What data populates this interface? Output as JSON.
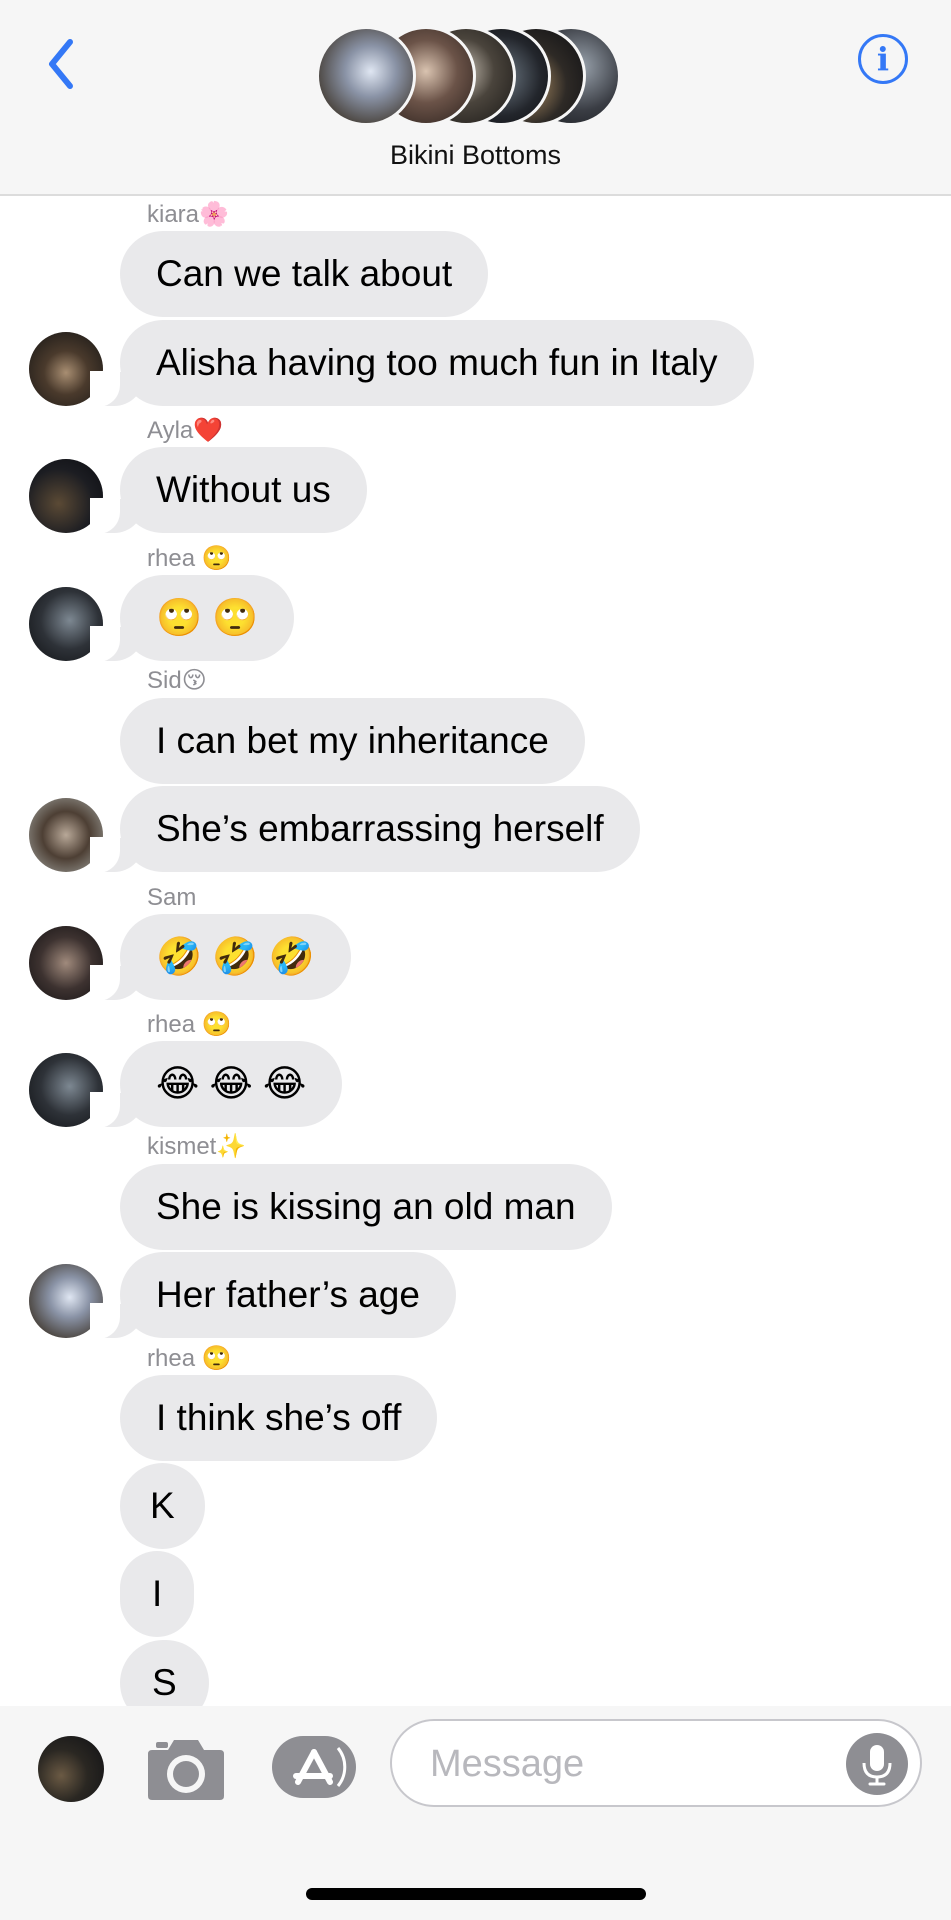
{
  "header": {
    "title": "Bikini Bottoms",
    "back_icon": "chevron-left-icon",
    "info_icon": "info-circle-icon",
    "info_glyph": "i"
  },
  "messages": [
    {
      "sender": "kiara🌸",
      "text": "Can we talk about"
    },
    {
      "text": "Alisha having too much fun in Italy"
    },
    {
      "sender": "Ayla❤️",
      "text": "Without us"
    },
    {
      "sender": "rhea 🙄",
      "text": "🙄 🙄"
    },
    {
      "sender": "Sid😚",
      "text": "I can bet my inheritance"
    },
    {
      "text": "She’s embarrassing herself"
    },
    {
      "sender": "Sam",
      "text": "🤣 🤣 🤣"
    },
    {
      "sender": "rhea 🙄",
      "text": "😂 😂 😂"
    },
    {
      "sender": "kismet✨",
      "text": "She is kissing an old man"
    },
    {
      "text": "Her father’s age"
    },
    {
      "sender": "rhea 🙄",
      "text": "I think she’s off"
    },
    {
      "text": "K"
    },
    {
      "text": "I"
    },
    {
      "text": "S"
    }
  ],
  "input": {
    "placeholder": "Message",
    "camera_icon": "camera-icon",
    "apps_icon": "app-store-icon",
    "mic_icon": "microphone-icon"
  },
  "colors": {
    "accent": "#3478f6",
    "bubble": "#e9e9eb",
    "sender": "#8e8e93",
    "header_bg": "#f6f6f6"
  }
}
